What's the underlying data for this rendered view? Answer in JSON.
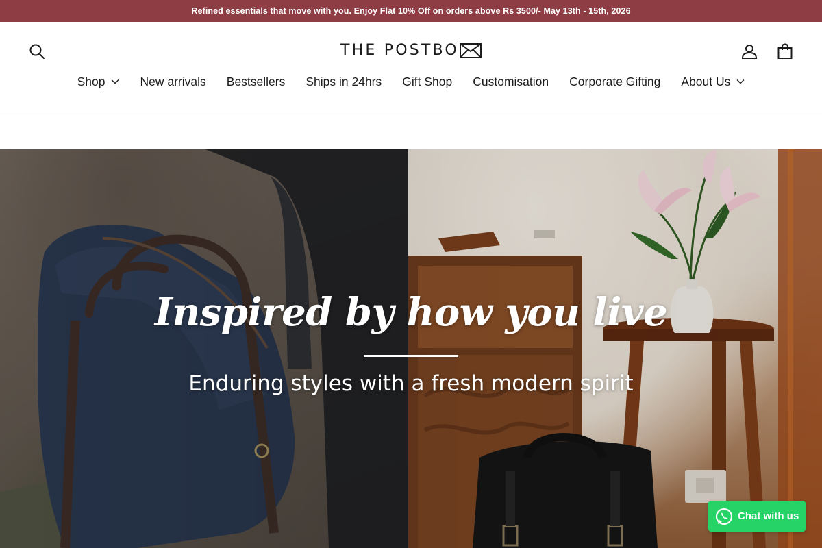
{
  "announcement": {
    "text": "Refined essentials that move with you. Enjoy Flat 10% Off on orders above Rs 3500/- May 13th - 15th, 2026"
  },
  "header": {
    "logo_text": "THE POSTBO",
    "icons": {
      "search": "search-icon",
      "account": "user-icon",
      "cart": "shopping-bag-icon",
      "logo_mark": "envelope-icon"
    }
  },
  "nav": {
    "items": [
      {
        "label": "Shop",
        "has_dropdown": true
      },
      {
        "label": "New arrivals",
        "has_dropdown": false
      },
      {
        "label": "Bestsellers",
        "has_dropdown": false
      },
      {
        "label": "Ships in 24hrs",
        "has_dropdown": false
      },
      {
        "label": "Gift Shop",
        "has_dropdown": false
      },
      {
        "label": "Customisation",
        "has_dropdown": false
      },
      {
        "label": "Corporate Gifting",
        "has_dropdown": false
      },
      {
        "label": "About Us",
        "has_dropdown": true
      }
    ]
  },
  "hero": {
    "title": "Inspired by how you live",
    "subtitle": "Enduring styles with a fresh modern spirit"
  },
  "chat": {
    "label": "Chat with us",
    "icon": "whatsapp-icon"
  },
  "colors": {
    "announcement_bg": "#8e3d45",
    "chat_bg": "#25d366",
    "text": "#1c1c1c"
  }
}
